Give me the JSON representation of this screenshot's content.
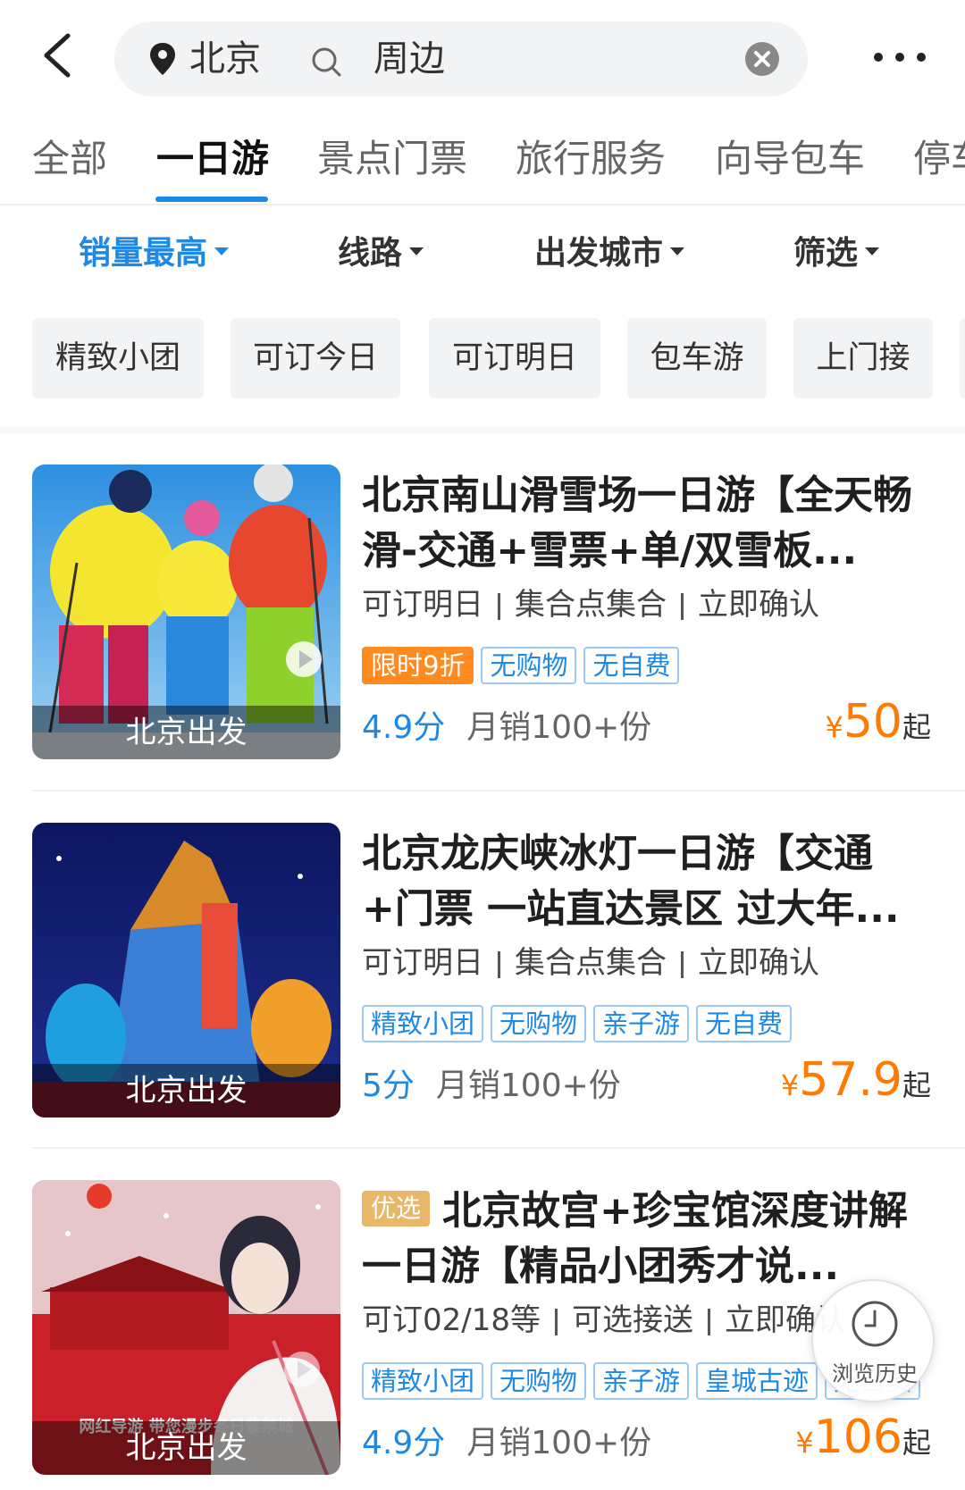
{
  "header": {
    "city": "北京",
    "query": "周边"
  },
  "tabs": [
    {
      "label": "全部"
    },
    {
      "label": "一日游"
    },
    {
      "label": "景点门票"
    },
    {
      "label": "旅行服务"
    },
    {
      "label": "向导包车"
    },
    {
      "label": "停车"
    }
  ],
  "active_tab": "一日游",
  "sortbar": {
    "sales": "销量最高",
    "route": "线路",
    "departure": "出发城市",
    "filter": "筛选"
  },
  "chips": [
    {
      "label": "精致小团"
    },
    {
      "label": "可订今日"
    },
    {
      "label": "可订明日"
    },
    {
      "label": "包车游"
    },
    {
      "label": "上门接"
    }
  ],
  "products": [
    {
      "title": "北京南山滑雪场一日游【全天畅滑-交通+雪票+单/双雪板...",
      "badge": "",
      "thumb_label": "北京出发",
      "meta": [
        "可订明日",
        "集合点集合",
        "立即确认"
      ],
      "tags": [
        {
          "label": "限时9折",
          "style": "discount"
        },
        {
          "label": "无购物",
          "style": "outline"
        },
        {
          "label": "无自费",
          "style": "outline"
        }
      ],
      "score": "4.9分",
      "sales": "月销100+份",
      "price_symbol": "¥",
      "price": "50",
      "price_suffix": "起"
    },
    {
      "title": "北京龙庆峡冰灯一日游【交通+门票 一站直达景区 过大年...",
      "badge": "",
      "thumb_label": "北京出发",
      "meta": [
        "可订明日",
        "集合点集合",
        "立即确认"
      ],
      "tags": [
        {
          "label": "精致小团",
          "style": "outline"
        },
        {
          "label": "无购物",
          "style": "outline"
        },
        {
          "label": "亲子游",
          "style": "outline"
        },
        {
          "label": "无自费",
          "style": "outline"
        }
      ],
      "score": "5分",
      "sales": "月销100+份",
      "price_symbol": "¥",
      "price": "57.9",
      "price_suffix": "起"
    },
    {
      "title": "北京故宫+珍宝馆深度讲解一日游【精品小团秀才说...",
      "badge": "优选",
      "thumb_label": "北京出发",
      "thumb_caption": "网红导游 带您漫步冬日紫禁城",
      "meta": [
        "可订02/18等",
        "可选接送",
        "立即确认"
      ],
      "tags": [
        {
          "label": "精致小团",
          "style": "outline"
        },
        {
          "label": "无购物",
          "style": "outline"
        },
        {
          "label": "亲子游",
          "style": "outline"
        },
        {
          "label": "皇城古迹",
          "style": "outline"
        },
        {
          "label": "无自费",
          "style": "outline"
        }
      ],
      "score": "4.9分",
      "sales": "月销100+份",
      "price_symbol": "¥",
      "price": "106",
      "price_suffix": "起"
    }
  ],
  "history": {
    "label": "浏览历史"
  },
  "colors": {
    "accent": "#1e88e5",
    "price": "#ff7a00",
    "discount": "#ff8a1f",
    "badge": "#e8b76a"
  }
}
